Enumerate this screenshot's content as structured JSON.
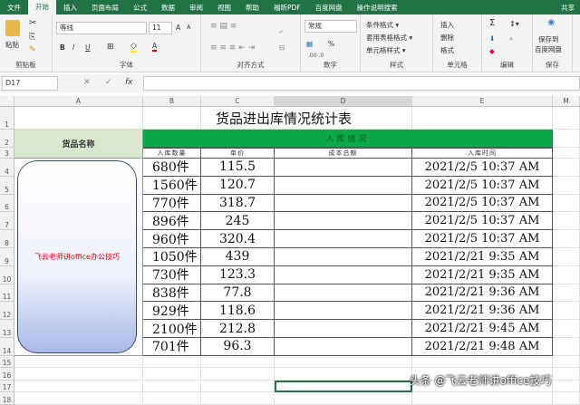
{
  "ribbon_tabs": [
    "文件",
    "开始",
    "插入",
    "页面布局",
    "公式",
    "数据",
    "审阅",
    "视图",
    "帮助",
    "福昕PDF",
    "百度网盘"
  ],
  "search_label": "操作说明搜索",
  "share_label": "共享",
  "clipboard": {
    "paste": "粘贴",
    "label": "剪贴板"
  },
  "font": {
    "name": "等线",
    "size": "11",
    "label": "字体",
    "bold": "B",
    "italic": "I",
    "underline": "U",
    "grow": "A",
    "shrink": "A",
    "color": "A"
  },
  "alignment": {
    "label": "对齐方式"
  },
  "number": {
    "format": "常规",
    "percent": "%",
    "label": "数字"
  },
  "styles": {
    "conditional": "条件格式 ▾",
    "table": "套用表格格式 ▾",
    "cell": "单元格样式 ▾",
    "label": "样式"
  },
  "cells": {
    "insert": "插入",
    "delete": "删除",
    "format": "格式",
    "label": "单元格"
  },
  "editing": {
    "label": "编辑",
    "sum": "Σ"
  },
  "save": {
    "line1": "保存到",
    "line2": "百度网盘",
    "label": "保存"
  },
  "name_box": "D17",
  "fx": "fx",
  "columns": [
    "A",
    "B",
    "C",
    "D",
    "E",
    "M"
  ],
  "rows": [
    "1",
    "2",
    "3",
    "4",
    "5",
    "6",
    "7",
    "8",
    "9",
    "10",
    "11",
    "12",
    "13",
    "14",
    "15",
    "16",
    "17",
    "18"
  ],
  "title": "货品进出库情况统计表",
  "header_name": "货品名称",
  "header_group": "入库情况",
  "subheaders": [
    "入库数量",
    "单价",
    "成本总额",
    "入库时间"
  ],
  "shape_text": "飞云老师讲office办公技巧",
  "data_rows": [
    [
      "680件",
      "115.5",
      "",
      "2021/2/5 10:37 AM"
    ],
    [
      "1560件",
      "120.7",
      "",
      "2021/2/5 10:37 AM"
    ],
    [
      "770件",
      "318.7",
      "",
      "2021/2/5 10:37 AM"
    ],
    [
      "896件",
      "245",
      "",
      "2021/2/5 10:37 AM"
    ],
    [
      "960件",
      "320.4",
      "",
      "2021/2/5 10:37 AM"
    ],
    [
      "1050件",
      "439",
      "",
      "2021/2/21 9:35 AM"
    ],
    [
      "730件",
      "123.3",
      "",
      "2021/2/21 9:35 AM"
    ],
    [
      "838件",
      "77.8",
      "",
      "2021/2/21 9:36 AM"
    ],
    [
      "929件",
      "118.6",
      "",
      "2021/2/21 9:36 AM"
    ],
    [
      "2100件",
      "212.8",
      "",
      "2021/2/21 9:45 AM"
    ],
    [
      "701件",
      "96.3",
      "",
      "2021/2/21 9:48 AM"
    ]
  ],
  "watermark": "头条 @飞云老师讲office技巧",
  "colors": {
    "excel_green": "#217346",
    "header_green": "#0aa846",
    "name_bg": "#d8e8cf"
  }
}
